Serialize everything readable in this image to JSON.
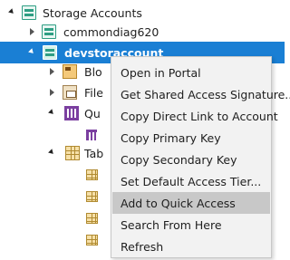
{
  "tree": {
    "root": {
      "label": "Storage Accounts",
      "icon": "storage-account-icon",
      "expanded": true
    },
    "accounts": [
      {
        "label": "commondiag620",
        "icon": "storage-account-icon",
        "expanded": false
      },
      {
        "label": "devstoraccount",
        "icon": "storage-account-icon",
        "expanded": true,
        "selected": true
      }
    ],
    "children": [
      {
        "label": "Blob Containers",
        "visible_label": "Blo",
        "icon": "blob-container-icon",
        "expanded": false
      },
      {
        "label": "File Shares",
        "visible_label": "File",
        "icon": "file-share-icon",
        "expanded": false
      },
      {
        "label": "Queues",
        "visible_label": "Qu",
        "icon": "queue-icon",
        "expanded": true
      },
      {
        "label": "Tables",
        "visible_label": "Tab",
        "icon": "table-icon",
        "expanded": true
      }
    ]
  },
  "context_menu": {
    "items": [
      {
        "label": "Open in Portal"
      },
      {
        "label": "Get Shared Access Signature..."
      },
      {
        "label": "Copy Direct Link to Account"
      },
      {
        "label": "Copy Primary Key"
      },
      {
        "label": "Copy Secondary Key"
      },
      {
        "label": "Set Default Access Tier..."
      },
      {
        "label": "Add to Quick Access",
        "highlighted": true
      },
      {
        "label": "Search From Here"
      },
      {
        "label": "Refresh"
      }
    ]
  },
  "colors": {
    "selection": "#1a7fd4",
    "menu_background": "#f2f2f2",
    "menu_highlight": "#c8c8c8",
    "storage_icon": "#2e9e83"
  }
}
